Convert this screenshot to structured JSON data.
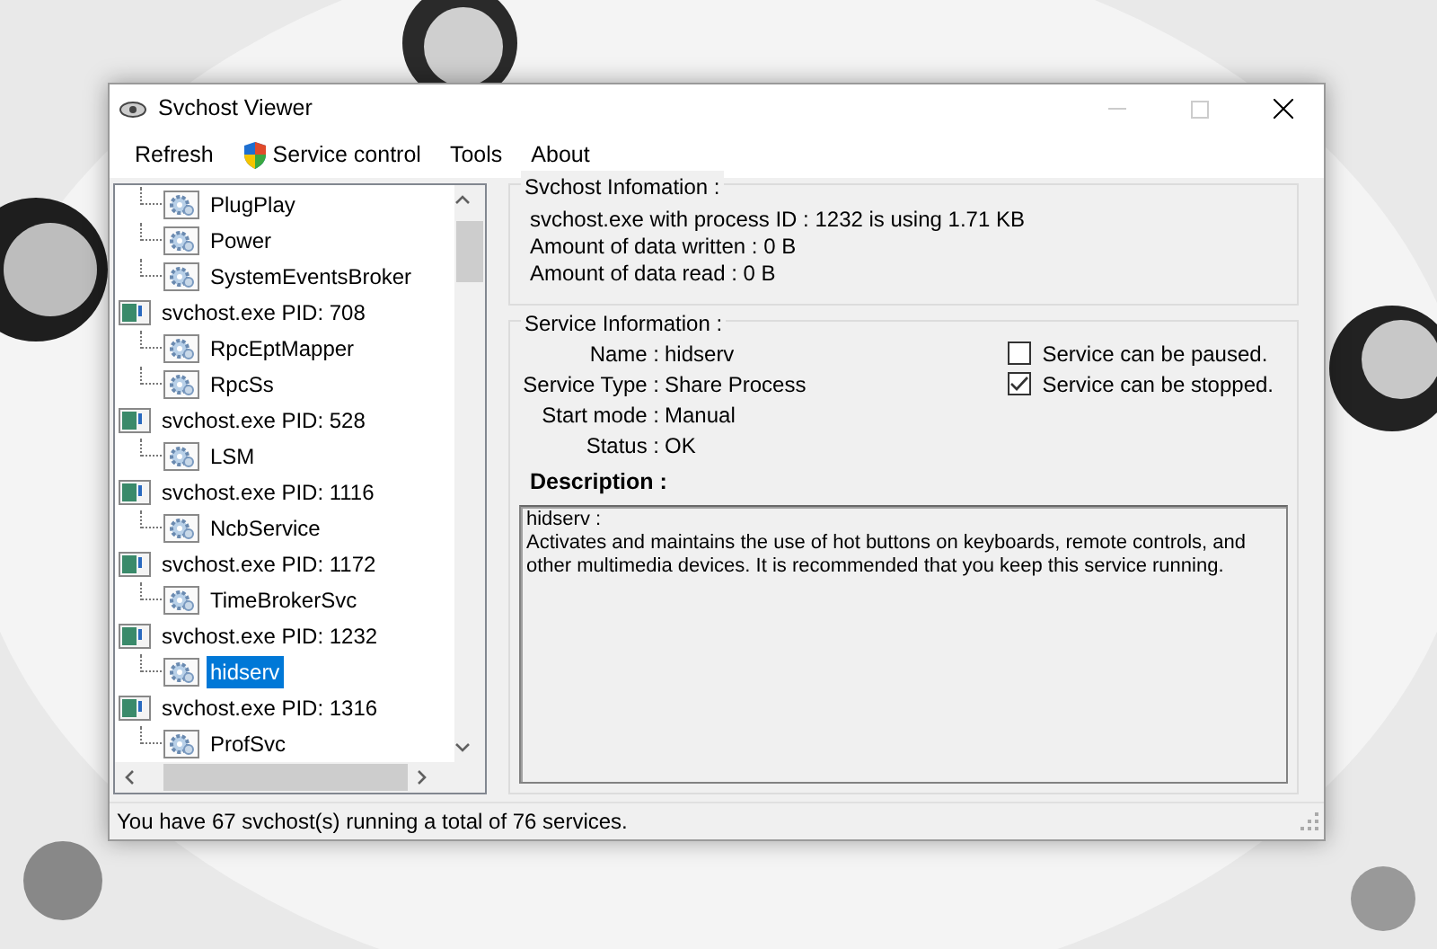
{
  "window": {
    "title": "Svchost Viewer"
  },
  "menu": [
    {
      "label": "Refresh",
      "kind": "plain"
    },
    {
      "label": "Service control",
      "kind": "shield"
    },
    {
      "label": "Tools",
      "kind": "plain"
    },
    {
      "label": "About",
      "kind": "plain"
    }
  ],
  "tree": [
    {
      "label": "PlugPlay",
      "kind": "service",
      "selected": false
    },
    {
      "label": "Power",
      "kind": "service",
      "selected": false
    },
    {
      "label": "SystemEventsBroker",
      "kind": "service",
      "selected": false
    },
    {
      "label": "svchost.exe PID: 708",
      "kind": "process",
      "selected": false,
      "children": [
        {
          "label": "RpcEptMapper",
          "kind": "service",
          "selected": false
        },
        {
          "label": "RpcSs",
          "kind": "service",
          "selected": false
        }
      ]
    },
    {
      "label": "svchost.exe PID: 528",
      "kind": "process",
      "selected": false,
      "children": [
        {
          "label": "LSM",
          "kind": "service",
          "selected": false
        }
      ]
    },
    {
      "label": "svchost.exe PID: 1116",
      "kind": "process",
      "selected": false,
      "children": [
        {
          "label": "NcbService",
          "kind": "service",
          "selected": false
        }
      ]
    },
    {
      "label": "svchost.exe PID: 1172",
      "kind": "process",
      "selected": false,
      "children": [
        {
          "label": "TimeBrokerSvc",
          "kind": "service",
          "selected": false
        }
      ]
    },
    {
      "label": "svchost.exe PID: 1232",
      "kind": "process",
      "selected": false,
      "children": [
        {
          "label": "hidserv",
          "kind": "service",
          "selected": true
        }
      ]
    },
    {
      "label": "svchost.exe PID: 1316",
      "kind": "process",
      "selected": false,
      "children": [
        {
          "label": "ProfSvc",
          "kind": "service",
          "selected": false
        }
      ]
    }
  ],
  "svchost_info": {
    "title": "Svchost Infomation :",
    "lines": [
      "svchost.exe with process ID : 1232 is using 1.71 KB",
      "Amount of data written : 0 B",
      "Amount of data read : 0 B"
    ]
  },
  "service_info": {
    "title": "Service Information :",
    "fields": [
      {
        "label": "Name :",
        "value": "hidserv"
      },
      {
        "label": "Service Type :",
        "value": "Share Process"
      },
      {
        "label": "Start mode :",
        "value": "Manual"
      },
      {
        "label": "Status :",
        "value": "OK"
      }
    ],
    "options": [
      {
        "label": "Service can be paused.",
        "checked": false
      },
      {
        "label": "Service can be stopped.",
        "checked": true
      }
    ],
    "description_label": "Description :",
    "description": [
      "hidserv :",
      "Activates and maintains the use of hot buttons on keyboards, remote controls, and other multimedia devices. It is recommended that you keep this service running."
    ]
  },
  "status_bar": "You have 67 svchost(s) running a total of 76 services."
}
